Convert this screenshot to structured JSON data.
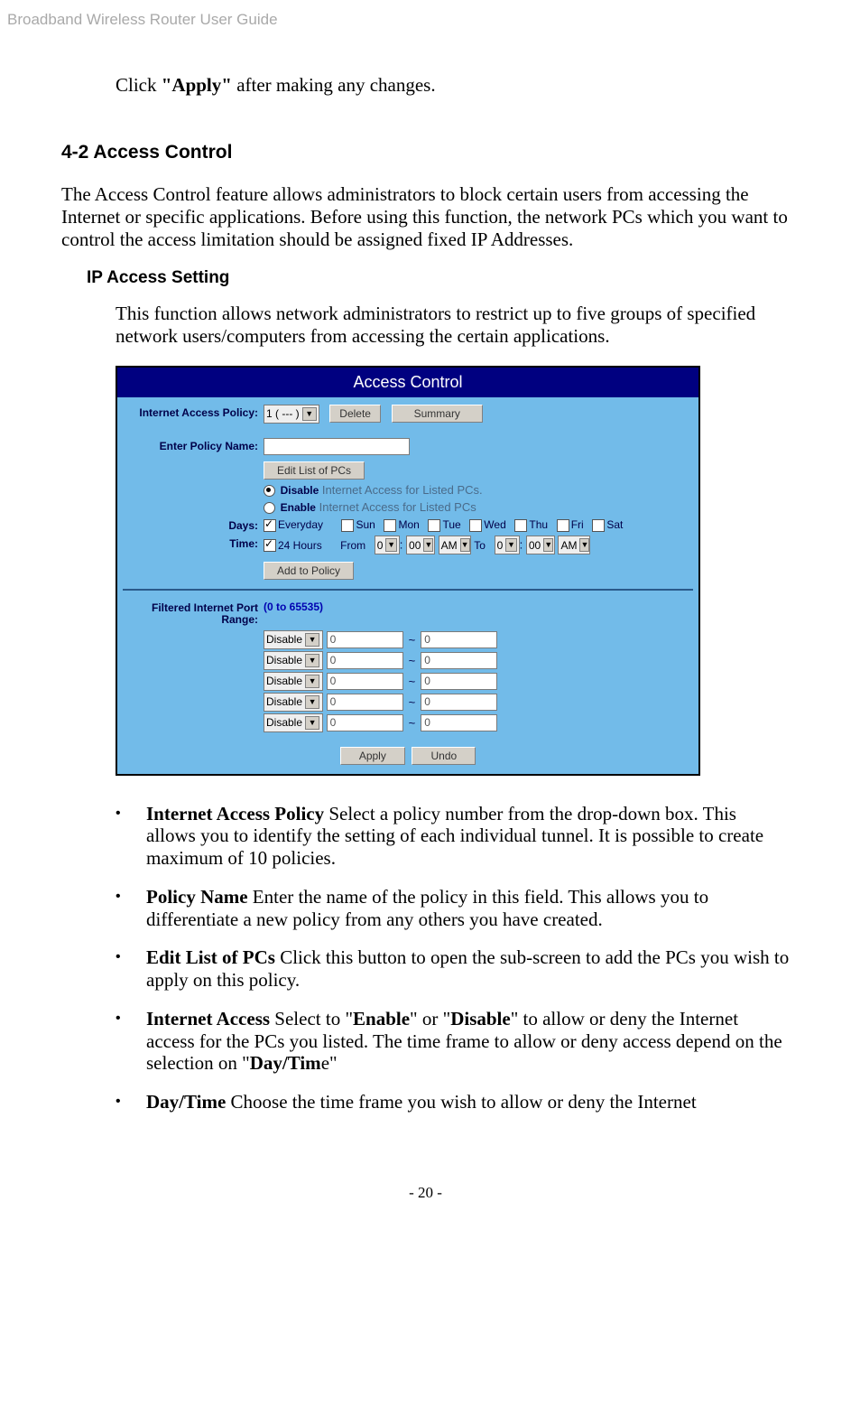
{
  "header": "Broadband Wireless Router User Guide",
  "intro": {
    "click": "Click ",
    "apply_bold": "\"Apply\"",
    "after": " after making any changes."
  },
  "section": {
    "heading": "4-2 Access Control",
    "para": "The Access Control feature allows administrators to block certain users from accessing the Internet or specific applications. Before using this function, the network PCs which you want to control the access limitation should be assigned fixed IP Addresses.",
    "subheading": "IP Access Setting",
    "subpara": "This function allows network administrators to restrict up to five groups of specified network users/computers from accessing the certain applications."
  },
  "screenshot": {
    "title": "Access Control",
    "labels": {
      "policy": "Internet Access Policy:",
      "policy_name": "Enter Policy Name:",
      "days": "Days:",
      "time": "Time:",
      "port_range": "Filtered Internet Port Range:"
    },
    "policy_select": "1 ( --- )",
    "delete_btn": "Delete",
    "summary_btn": "Summary",
    "edit_list_btn": "Edit List of PCs",
    "disable_bold": "Disable",
    "disable_rest": " Internet Access for Listed PCs.",
    "enable_bold": "Enable",
    "enable_rest": " Internet Access for Listed PCs",
    "everyday": "Everyday",
    "day_labels": [
      "Sun",
      "Mon",
      "Tue",
      "Wed",
      "Thu",
      "Fri",
      "Sat"
    ],
    "hours24": "24 Hours",
    "from": "From",
    "to": "To",
    "time_vals": {
      "h1": "0",
      "m1": "00",
      "ap1": "AM",
      "h2": "0",
      "m2": "00",
      "ap2": "AM"
    },
    "add_policy_btn": "Add to Policy",
    "port_note": "(0 to 65535)",
    "port_proto": "Disable",
    "port_val": "0",
    "apply_btn": "Apply",
    "undo_btn": "Undo"
  },
  "bullets": [
    {
      "bold": "Internet Access Policy",
      "rest": " Select a policy number from the drop-down box. This allows you to identify the setting of each individual tunnel. It is possible to create maximum of 10 policies."
    },
    {
      "bold": "Policy Name",
      "rest": " Enter the name of the policy in this field. This allows you to differentiate a new policy from any others you have created."
    },
    {
      "bold": "Edit List of PCs",
      "rest": " Click this button to open the sub-screen to add the PCs you wish to apply on this policy."
    },
    {
      "bold": "Internet Access",
      "rest": " Select to \"",
      "b2": "Enable",
      "rest2": "\" or \"",
      "b3": "Disable",
      "rest3": "\" to allow or deny the Internet access for the PCs you listed. The time frame to allow or deny access depend on the selection on \"",
      "b4": "Day/Tim",
      "rest4": "e\""
    },
    {
      "bold": "Day/Time",
      "rest": " Choose the time frame you wish to allow or deny the Internet"
    }
  ],
  "footer": "- 20 -"
}
